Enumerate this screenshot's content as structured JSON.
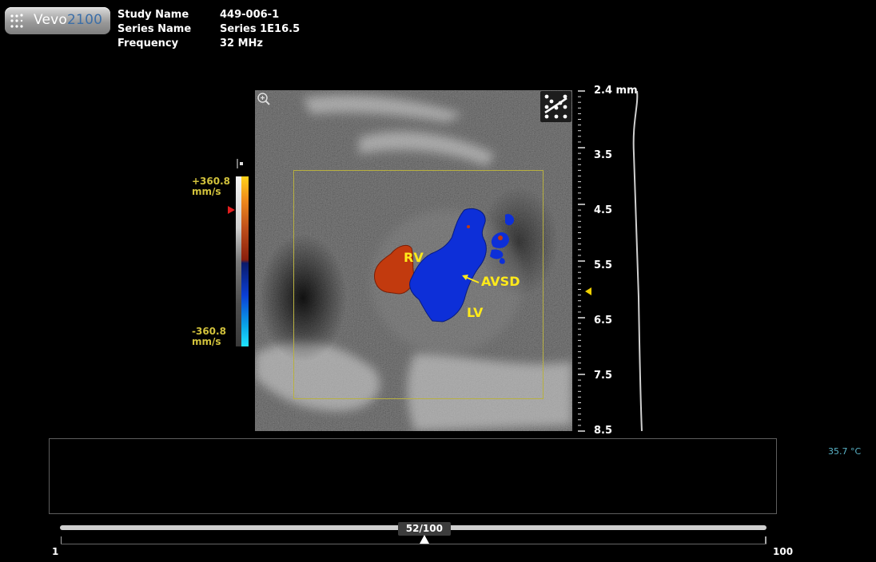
{
  "logo": {
    "name_part": "Vevo",
    "number_part": "2100"
  },
  "study": {
    "labels": [
      "Study Name",
      "Series Name",
      "Frequency"
    ],
    "values": [
      "449-006-1",
      "Series 1E16.5",
      "32 MHz"
    ]
  },
  "color_scale": {
    "max_value": "+360.8",
    "max_unit": "mm/s",
    "min_value": "-360.8",
    "min_unit": "mm/s",
    "baseline_marker_color": "#e31e1e"
  },
  "annotations": {
    "rv": "RV",
    "avsd": "AVSD",
    "lv": "LV",
    "color": "#ffea1a"
  },
  "depth_scale": {
    "labels": [
      "2.4 mm",
      "3.5",
      "4.5",
      "5.5",
      "6.5",
      "7.5",
      "8.5"
    ]
  },
  "temperature": "35.7 °C",
  "cine": {
    "frame_display": "52/100",
    "current_frame": 52,
    "total_frames": 100,
    "min_label": "1",
    "max_label": "100"
  },
  "icons": {
    "logo": "vevo-dots-icon",
    "zoom": "zoom-in-icon",
    "mode": "doppler-mode-icon",
    "colorbar": "colorbar-invert-icon"
  }
}
